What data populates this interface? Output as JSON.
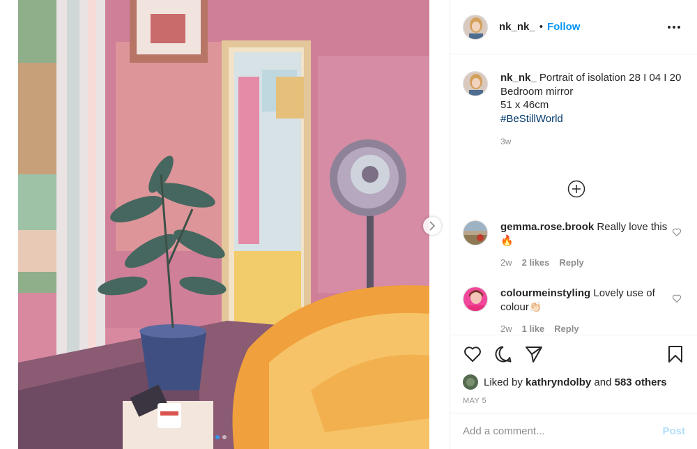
{
  "post": {
    "author": "nk_nk_",
    "separator": "•",
    "follow_label": "Follow",
    "more_icon": "more-horizontal-icon"
  },
  "caption": {
    "username": "nk_nk_",
    "lines": [
      "Portrait of isolation 28 I 04 I 20",
      "Bedroom mirror",
      "51 x 46cm"
    ],
    "hashtag": "#BeStillWorld",
    "time": "3w"
  },
  "load_more_icon": "plus-circle-icon",
  "comments": [
    {
      "username": "gemma.rose.brook",
      "text": "Really love this 🔥",
      "time": "2w",
      "likes": "2 likes",
      "reply": "Reply"
    },
    {
      "username": "colourmeinstyling",
      "text": "Lovely use of colour👏🏻",
      "time": "2w",
      "likes": "1 like",
      "reply": "Reply"
    }
  ],
  "actions": {
    "icons": [
      "heart-icon",
      "comment-icon",
      "share-icon",
      "bookmark-icon"
    ]
  },
  "likes": {
    "prefix": "Liked by",
    "user": "kathryndolby",
    "and": "and",
    "others": "583 others"
  },
  "date": "MAY 5",
  "composer": {
    "placeholder": "Add a comment...",
    "post_label": "Post"
  },
  "colors": {
    "accent": "#0095f6",
    "post_disabled": "#b2dffc",
    "hashtag": "#00376b",
    "muted": "#8e8e8e"
  }
}
